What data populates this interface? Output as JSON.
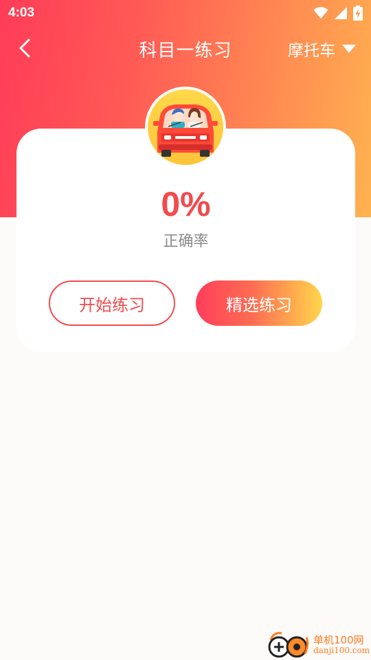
{
  "status_bar": {
    "time": "4:03",
    "icons": [
      "wifi-icon",
      "signal-icon",
      "battery-charging-icon"
    ]
  },
  "app_bar": {
    "title": "科目一练习",
    "vehicle_type": "摩托车",
    "back_icon": "chevron-left-icon",
    "dropdown_icon": "caret-down-icon"
  },
  "stats": {
    "accuracy": "0%",
    "accuracy_label": "正确率"
  },
  "actions": {
    "start_label": "开始练习",
    "selected_label": "精选练习"
  },
  "watermark": {
    "name": "单机100网",
    "url": "danji100.com"
  },
  "colors": {
    "primary": "#f24a4d",
    "gradient_start": "#ff3c58",
    "gradient_end": "#ffb250",
    "button_gradient_end": "#ffd64c"
  }
}
